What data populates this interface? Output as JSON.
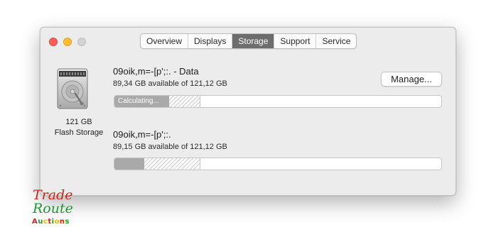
{
  "window": {
    "tabs": [
      {
        "label": "Overview",
        "active": false
      },
      {
        "label": "Displays",
        "active": false
      },
      {
        "label": "Storage",
        "active": true
      },
      {
        "label": "Support",
        "active": false
      },
      {
        "label": "Service",
        "active": false
      }
    ]
  },
  "disk": {
    "size": "121 GB",
    "type": "Flash Storage",
    "icon": "hard-drive-icon"
  },
  "volumes": [
    {
      "name": "09oik,m=-[p';:. - Data",
      "available": "89,34 GB available of 121,12 GB",
      "status": "Calculating...",
      "manage_label": "Manage..."
    },
    {
      "name": "09oik,m=-[p';:.",
      "available": "89,15 GB available of 121,12 GB"
    }
  ],
  "watermark": {
    "line1": "Trade",
    "line2": "Route",
    "line3": "Auctions",
    "colors": {
      "trade": "#c8261c",
      "route": "#1d9a2c",
      "auctions": [
        "#c8261c",
        "#1d9a2c",
        "#e8b511"
      ]
    }
  }
}
